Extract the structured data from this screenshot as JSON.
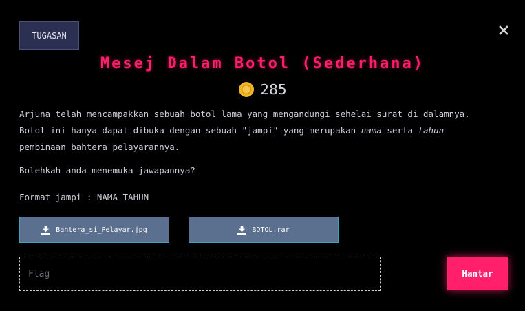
{
  "header": {
    "category_label": "TUGASAN",
    "title": "Mesej Dalam Botol (Sederhana)",
    "points": "285"
  },
  "description": {
    "line1": "Arjuna telah mencampakkan sebuah botol lama yang mengandungi sehelai surat di dalamnya.",
    "line2_part1": "Botol ini hanya dapat dibuka dengan sebuah \"jampi\" yang merupakan ",
    "line2_em1": "nama",
    "line2_part2": " serta ",
    "line2_em2": "tahun",
    "line3": "pembinaan bahtera pelayarannya.",
    "question": "Bolehkah anda menemuka jawapannya?",
    "format": "Format jampi : NAMA_TAHUN"
  },
  "files": [
    {
      "label": "Bahtera_si_Pelayar.jpg",
      "icon": "download-icon"
    },
    {
      "label": "BOTOL.rar",
      "icon": "download-icon"
    }
  ],
  "flag_input": {
    "placeholder": "Flag",
    "value": ""
  },
  "submit": {
    "label": "Hantar"
  },
  "colors": {
    "accent": "#ff1f6b",
    "category_bg": "#2b2f52",
    "file_button_bg": "#5b6f8e",
    "file_button_border": "#3aa6b9",
    "coin": "#f2b62a"
  }
}
